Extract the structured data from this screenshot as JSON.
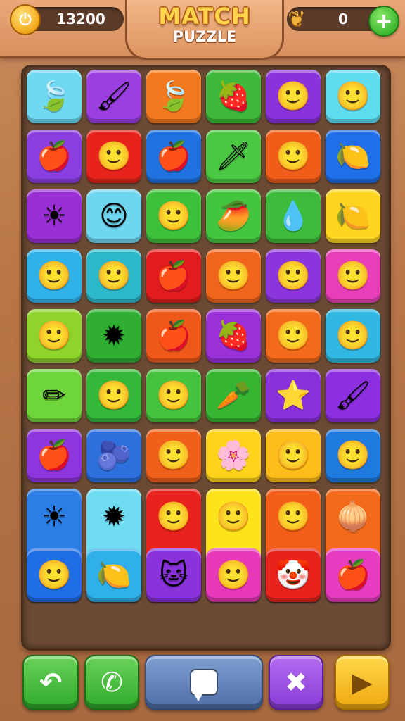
{
  "header": {
    "title": "MATCH",
    "subtitle": "PUZZLE",
    "coins": "13200",
    "gems": "0",
    "coin_icon": "coin-icon",
    "gem_icon": "leaf-icon",
    "plus_label": "+"
  },
  "board": {
    "tiles": [
      {
        "name": "leaf",
        "glyph": "🍃",
        "color": "#6fd9f2"
      },
      {
        "name": "brush",
        "glyph": "🖌",
        "color": "#9b3fe0"
      },
      {
        "name": "leaf",
        "glyph": "🍃",
        "color": "#f2791e"
      },
      {
        "name": "strawberry",
        "glyph": "🍓",
        "color": "#3db83a"
      },
      {
        "name": "smiley-fruit",
        "glyph": "🙂",
        "color": "#8a33dd"
      },
      {
        "name": "smiley-fruit",
        "glyph": "🙂",
        "color": "#5fdcf0"
      },
      {
        "name": "apple",
        "glyph": "🍎",
        "color": "#8b3fe0"
      },
      {
        "name": "smiley",
        "glyph": "🙂",
        "color": "#e8231c"
      },
      {
        "name": "apple",
        "glyph": "🍎",
        "color": "#1f72e0"
      },
      {
        "name": "arrow",
        "glyph": "🗡",
        "color": "#4bc842"
      },
      {
        "name": "smiley",
        "glyph": "🙂",
        "color": "#f05d18"
      },
      {
        "name": "lemon",
        "glyph": "🍋",
        "color": "#1f6fe8"
      },
      {
        "name": "sun-star",
        "glyph": "☀",
        "color": "#9b2fd6"
      },
      {
        "name": "blob-face",
        "glyph": "😊",
        "color": "#6fd6f0"
      },
      {
        "name": "green-face",
        "glyph": "🙂",
        "color": "#3cc23a"
      },
      {
        "name": "drop",
        "glyph": "🥭",
        "color": "#43c63e"
      },
      {
        "name": "blue-face",
        "glyph": "💧",
        "color": "#3cbc3a"
      },
      {
        "name": "lemon",
        "glyph": "🍋",
        "color": "#ffd51f"
      },
      {
        "name": "smiley",
        "glyph": "🙂",
        "color": "#2fb1ea"
      },
      {
        "name": "smiley",
        "glyph": "🙂",
        "color": "#2bb8c9"
      },
      {
        "name": "apple",
        "glyph": "🍎",
        "color": "#e21c1c"
      },
      {
        "name": "smiley",
        "glyph": "🙂",
        "color": "#f0641c"
      },
      {
        "name": "smiley",
        "glyph": "🙂",
        "color": "#8b35dc"
      },
      {
        "name": "smiley",
        "glyph": "🙂",
        "color": "#e83fb8"
      },
      {
        "name": "smiley",
        "glyph": "🙂",
        "color": "#8ed42a"
      },
      {
        "name": "star-face",
        "glyph": "✹",
        "color": "#2fae32"
      },
      {
        "name": "apple",
        "glyph": "🍎",
        "color": "#f0581a"
      },
      {
        "name": "strawberry",
        "glyph": "🍓",
        "color": "#9a30d8"
      },
      {
        "name": "smiley",
        "glyph": "🙂",
        "color": "#f36a1a"
      },
      {
        "name": "green-blob",
        "glyph": "🙂",
        "color": "#31b8e2"
      },
      {
        "name": "pencil",
        "glyph": "✏",
        "color": "#6ed63a"
      },
      {
        "name": "smiley",
        "glyph": "🙂",
        "color": "#33b83a"
      },
      {
        "name": "yellow-blob",
        "glyph": "🙂",
        "color": "#44c43c"
      },
      {
        "name": "carrot-face",
        "glyph": "🥕",
        "color": "#35b532"
      },
      {
        "name": "star",
        "glyph": "⭐",
        "color": "#8b31dc"
      },
      {
        "name": "brush",
        "glyph": "🖌",
        "color": "#8c2fe0"
      },
      {
        "name": "apple",
        "glyph": "🍎",
        "color": "#8e35de"
      },
      {
        "name": "blue-drop",
        "glyph": "🫐",
        "color": "#2c6fdd"
      },
      {
        "name": "green-face",
        "glyph": "🙂",
        "color": "#f0601a"
      },
      {
        "name": "flower",
        "glyph": "🌸",
        "color": "#ffd31a"
      },
      {
        "name": "green-face",
        "glyph": "🙂",
        "color": "#ffbd1a"
      },
      {
        "name": "blue-face",
        "glyph": "🙂",
        "color": "#1f7ae0"
      },
      {
        "name": "sun-brush",
        "glyph": "☀",
        "color": "#2a7ee6",
        "tall": true,
        "glyph2": "🖌"
      },
      {
        "name": "star-brush",
        "glyph": "✹",
        "color": "#6fdcf2",
        "tall": true,
        "glyph2": "🖍"
      },
      {
        "name": "faces",
        "glyph": "🙂",
        "color": "#e8221c",
        "tall": true,
        "glyph2": "🙂"
      },
      {
        "name": "faces",
        "glyph": "🙂",
        "color": "#ffe31a",
        "tall": true,
        "glyph2": "🙂"
      },
      {
        "name": "faces",
        "glyph": "🙂",
        "color": "#f35e18",
        "tall": true,
        "glyph2": "🙂"
      },
      {
        "name": "onion-brush",
        "glyph": "🧅",
        "color": "#f46a1a",
        "tall": true,
        "glyph2": "🖌"
      },
      {
        "name": "blue-face",
        "glyph": "🙂",
        "color": "#1f6ee6"
      },
      {
        "name": "lemon",
        "glyph": "🍋",
        "color": "#2fb0ea"
      },
      {
        "name": "cat-face",
        "glyph": "🐱",
        "color": "#8a32dc"
      },
      {
        "name": "smiley",
        "glyph": "🙂",
        "color": "#e638b8"
      },
      {
        "name": "clown-face",
        "glyph": "🤡",
        "color": "#e8231c"
      },
      {
        "name": "apple",
        "glyph": "🍎",
        "color": "#e73cc0"
      }
    ]
  },
  "controls": {
    "undo_icon": "undo-icon",
    "call_icon": "phone-icon",
    "chat_icon": "chat-icon",
    "close_icon": "close-icon",
    "play_icon": "play-icon",
    "undo_glyph": "↶",
    "call_glyph": "✆",
    "close_glyph": "✖",
    "play_glyph": "▶"
  }
}
